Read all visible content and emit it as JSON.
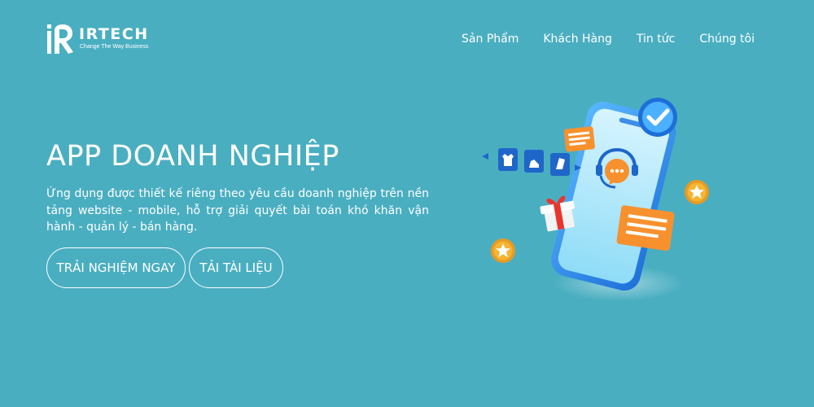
{
  "brand": {
    "name": "IRTECH",
    "tagline": "Change The Way Business"
  },
  "nav": {
    "items": [
      {
        "label": "Sản Phẩm"
      },
      {
        "label": "Khách Hàng"
      },
      {
        "label": "Tin tức"
      },
      {
        "label": "Chúng tôi"
      }
    ]
  },
  "hero": {
    "title": "APP DOANH NGHIỆP",
    "description": "Ứng dụng được thiết kế riêng theo yêu cầu doanh nghiệp trên nền tảng website - mobile, hỗ trợ giải quyết bài toán khó khăn vận hành - quản lý - bán hàng.",
    "primary_button": "TRẢI NGHIỆM NGAY",
    "secondary_button": "TẢI TÀI LIỆU"
  },
  "colors": {
    "background": "#4aaec1",
    "text": "#ffffff",
    "phone": "#2f7fe0",
    "accent_orange": "#f7912e",
    "accent_gold": "#f5b532"
  },
  "icons": [
    "irtech-logo-icon",
    "phone-illustration",
    "checkmark-badge-icon",
    "chat-bubble-icon",
    "headset-support-icon",
    "gift-box-icon",
    "star-coin-icon",
    "product-card-icon",
    "carousel-arrow-icon"
  ]
}
